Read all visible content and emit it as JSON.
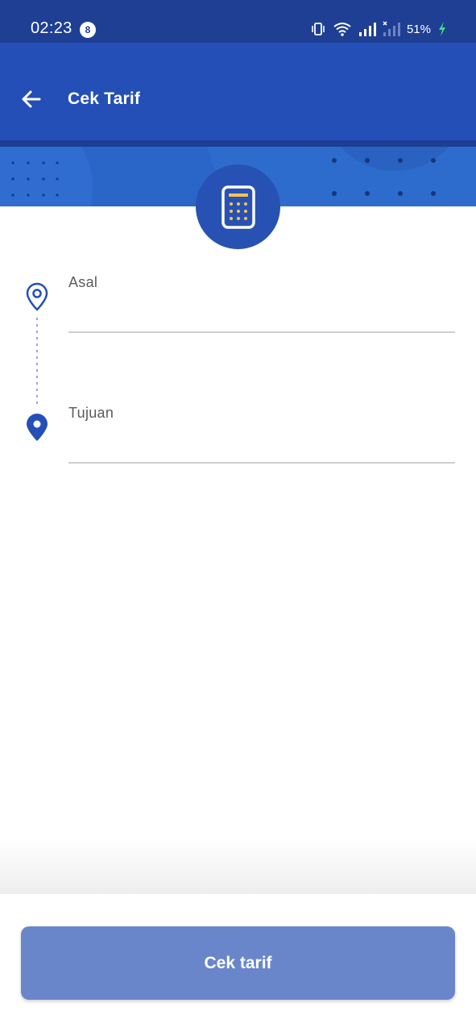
{
  "status_bar": {
    "time": "02:23",
    "notification_count": "8",
    "battery": "51%"
  },
  "header": {
    "title": "Cek Tarif",
    "back_icon": "arrow-left-icon"
  },
  "hero_icon": "calculator-icon",
  "form": {
    "origin_label": "Asal",
    "origin_value": "",
    "destination_label": "Tujuan",
    "destination_value": ""
  },
  "submit_label": "Cek tarif",
  "colors": {
    "primary": "#244fb6",
    "status_bar": "#1e3f93",
    "button_disabled": "#6a86cb",
    "calculator_accent": "#f5c451"
  }
}
